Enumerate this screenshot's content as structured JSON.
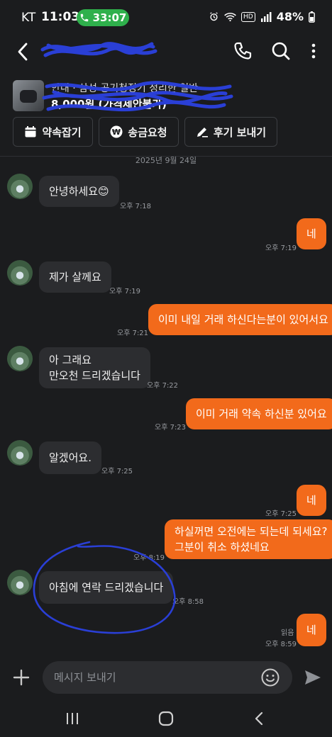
{
  "status_bar": {
    "carrier": "KT",
    "time": "11:03",
    "call_duration": "33:07",
    "battery": "48%",
    "hd_label": "HD"
  },
  "header": {
    "product_title": "안내 · 삼성 공기청정기 정리한 일반",
    "product_price": "8,000원 (가격제안불가)"
  },
  "actions": {
    "appointment": "약속잡기",
    "money_request": "송금요청",
    "review": "후기 보내기",
    "won_symbol": "₩"
  },
  "date": "2025년 9월 24일",
  "messages": [
    {
      "text": "안녕하세요😊",
      "time": "오후 7:18"
    },
    {
      "text": "네",
      "time": "오후 7:19"
    },
    {
      "text": "제가 살께요",
      "time": "오후 7:19"
    },
    {
      "text": "이미 내일 거래 하신다는분이 있어서요",
      "time": "오후 7:21"
    },
    {
      "line1": "아 그래요",
      "line2": "만오천 드리겠습니다",
      "time": "오후 7:22"
    },
    {
      "text": "이미 거래 약속 하신분 있어요",
      "time": "오후 7:23"
    },
    {
      "text": "알겠어요.",
      "time": "오후 7:25"
    },
    {
      "text": "네",
      "time": "오후 7:25"
    },
    {
      "line1": "하실꺼면 오전에는 되는데 되세요?",
      "line2": "그분이 취소 하셨네요",
      "time": "오후 8:19"
    },
    {
      "text": "아침에  연락  드리겠습니다",
      "time": "오후 8:58"
    },
    {
      "text": "네",
      "time": "오후 8:59",
      "read": "읽음"
    }
  ],
  "input": {
    "placeholder": "메시지 보내기"
  },
  "colors": {
    "accent": "#f26a1b",
    "background": "#1b1c1e",
    "bubble_in": "#2c2d30",
    "annotation": "#2a3fd6"
  }
}
